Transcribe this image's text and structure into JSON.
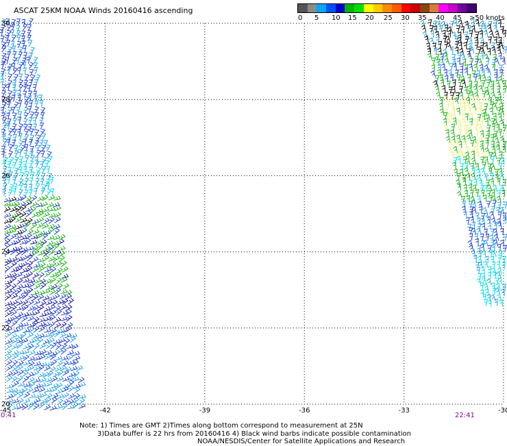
{
  "title": "ASCAT 25KM NOAA Winds 20160416 ascending",
  "colorbar": {
    "colors": [
      "#555555",
      "#8a8a8a",
      "#00a6ff",
      "#0050ff",
      "#0000c8",
      "#00b400",
      "#00e000",
      "#ffff00",
      "#ffcc00",
      "#ff8c00",
      "#ff5a00",
      "#ff0000",
      "#c80000",
      "#8b4513",
      "#d87d37",
      "#ff00ff",
      "#c800c8",
      "#7000a0",
      "#400070"
    ],
    "labels": [
      "0",
      "5",
      "10",
      "15",
      "20",
      "25",
      "30",
      "35",
      "40",
      "45",
      ">50 knots"
    ]
  },
  "axes": {
    "x_ticks": [
      "-45",
      "-42",
      "-39",
      "-36",
      "-33",
      "-30"
    ],
    "y_ticks": [
      "30",
      "28",
      "26",
      "24",
      "22",
      "20"
    ],
    "x_range": [
      -45,
      -30
    ],
    "y_range": [
      20,
      30
    ]
  },
  "times": {
    "left": "0:41",
    "right": "22:41"
  },
  "notes": [
    "Note: 1) Times are GMT 2)Times along bottom correspond to measurement at 25N",
    "3)Data buffer is 22 hrs from 20160416 4) Black wind barbs indicate possible contamination",
    "NOAA/NESDIS/Center for Satellite Applications and Research"
  ],
  "barb_colors": {
    "light_blue": "#1fa4e6",
    "cyan": "#00dcee",
    "blue": "#1e3fd6",
    "dark_blue": "#1010a0",
    "green": "#12b012",
    "yellow": "#f0f07a",
    "black": "#000000"
  }
}
